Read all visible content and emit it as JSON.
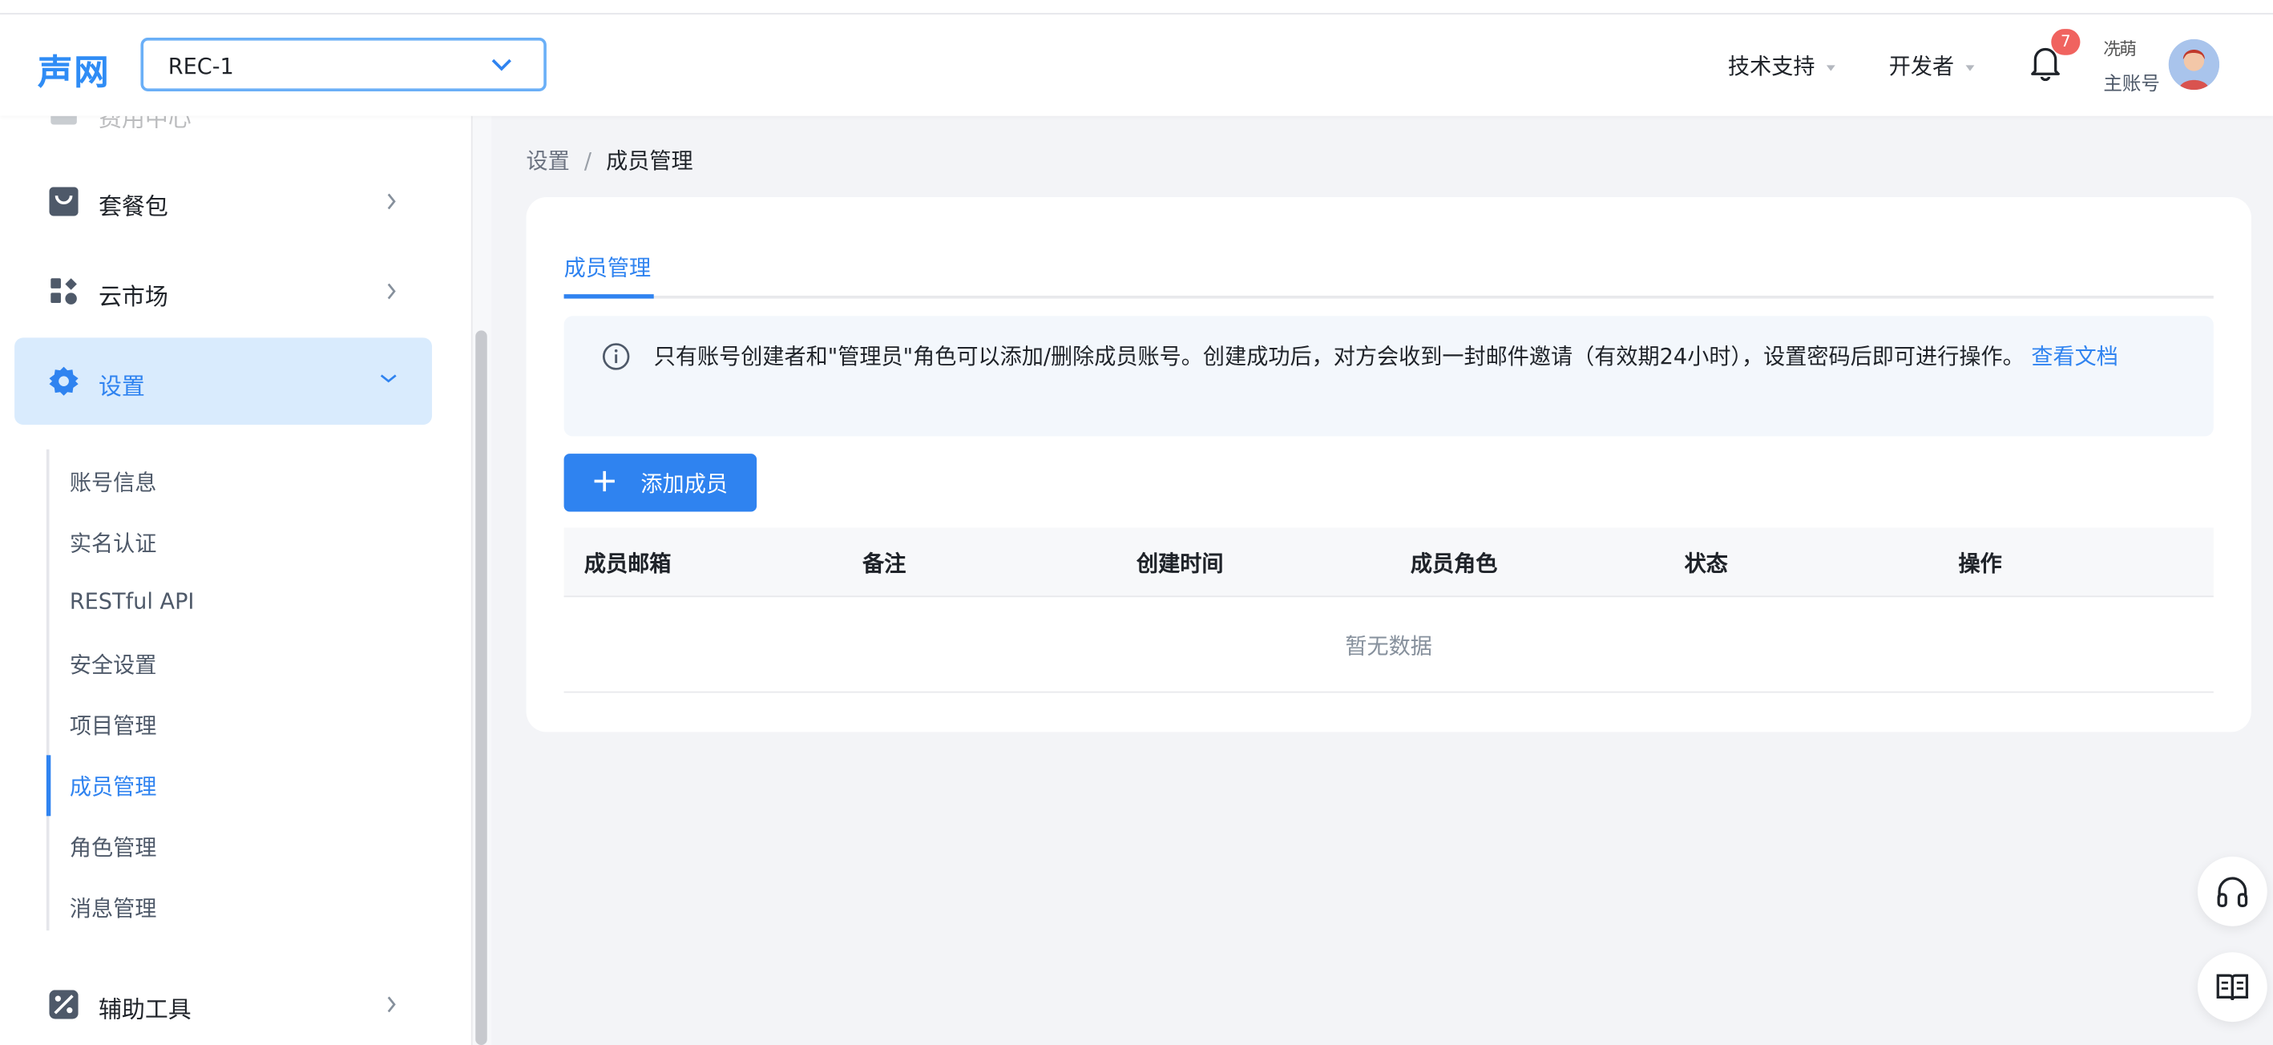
{
  "header": {
    "logo": "声网",
    "project": "REC-1",
    "nav_support": "技术支持",
    "nav_developer": "开发者",
    "notification_count": "7",
    "user_name": "冼萌",
    "user_role": "主账号"
  },
  "sidebar": {
    "top_faded": "费用中心",
    "items": [
      {
        "label": "套餐包",
        "icon": "bag-icon"
      },
      {
        "label": "云市场",
        "icon": "apps-icon"
      },
      {
        "label": "设置",
        "icon": "gear-icon"
      }
    ],
    "settings_sub": [
      "账号信息",
      "实名认证",
      "RESTful API",
      "安全设置",
      "项目管理",
      "成员管理",
      "角色管理",
      "消息管理"
    ],
    "bottom_item": {
      "label": "辅助工具",
      "icon": "tools-icon"
    }
  },
  "breadcrumb": {
    "parent": "设置",
    "separator": "/",
    "current": "成员管理"
  },
  "main": {
    "tab": "成员管理",
    "notice_text": "只有账号创建者和\"管理员\"角色可以添加/删除成员账号。创建成功后，对方会收到一封邮件邀请（有效期24小时），设置密码后即可进行操作。",
    "notice_link": "查看文档",
    "add_button": "添加成员",
    "columns": [
      "成员邮箱",
      "备注",
      "创建时间",
      "成员角色",
      "状态",
      "操作"
    ],
    "empty_text": "暂无数据"
  },
  "colors": {
    "primary": "#2f83f0",
    "active_bg": "#d9ebfd",
    "badge": "#f0635f"
  }
}
